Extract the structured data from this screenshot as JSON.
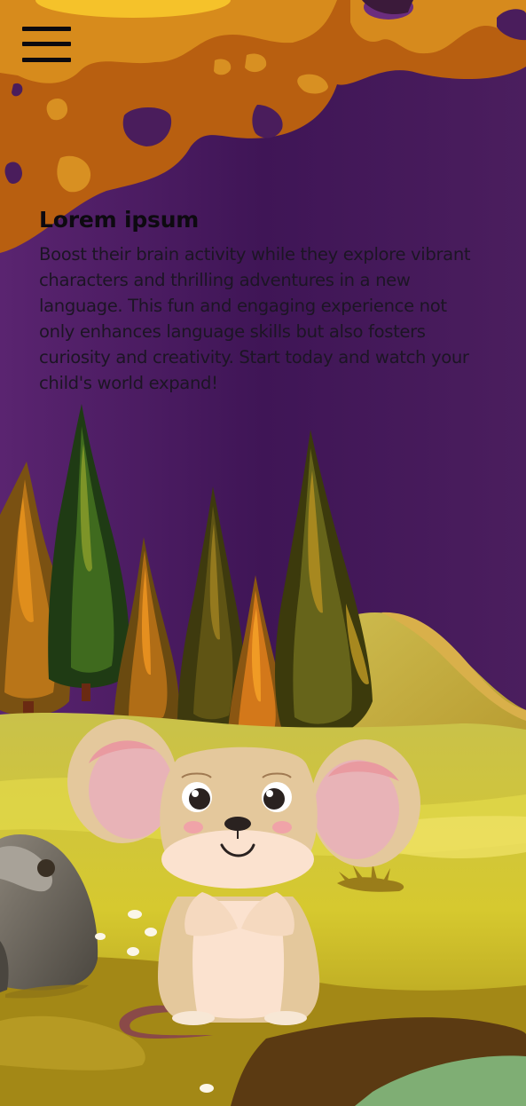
{
  "menu": {
    "icon": "hamburger-menu-icon"
  },
  "content": {
    "headline": "Lorem ipsum",
    "body": "Boost their brain activity while they explore vibrant characters and thrilling adventures in a new language. This fun and engaging experience not only enhances language skills but also fosters curiosity and creativity. Start today and watch your child's world expand!"
  },
  "colors": {
    "sky": "#4a1d5c",
    "cloud": "#c97a17",
    "grass": "#d4c63c",
    "mouse_fur": "#e6c79b",
    "mouse_ear_inner": "#e8b3b7"
  }
}
